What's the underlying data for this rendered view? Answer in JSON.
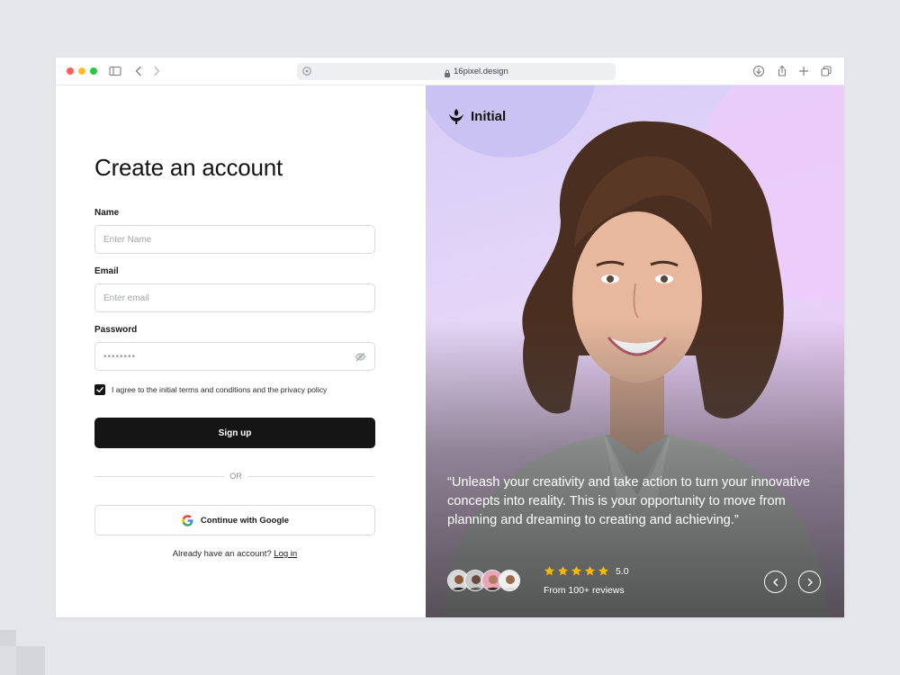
{
  "browser": {
    "url": "16pixel.design"
  },
  "form": {
    "title": "Create an account",
    "name_label": "Name",
    "name_placeholder": "Enter Name",
    "email_label": "Email",
    "email_placeholder": "Enter email",
    "password_label": "Password",
    "password_value": "••••••••",
    "terms_text": "I agree to the initial terms and conditions and the privacy policy",
    "terms_checked": true,
    "signup_label": "Sign up",
    "divider_text": "OR",
    "google_label": "Continue with Google",
    "login_prompt": "Already have an account?",
    "login_link": "Log in"
  },
  "hero": {
    "brand": "Initial",
    "quote": "“Unleash your creativity and take action to turn your innovative concepts into reality. This is your opportunity to move from planning and dreaming to creating and achieving.”",
    "rating_value": "5.0",
    "rating_stars": 5,
    "reviews_text": "From 100+ reviews",
    "prev_icon": "chevron-left-icon",
    "next_icon": "chevron-right-icon"
  },
  "colors": {
    "primary_button": "#151515",
    "star": "#f5b90a",
    "hero_bg": "#e6d6f8"
  }
}
